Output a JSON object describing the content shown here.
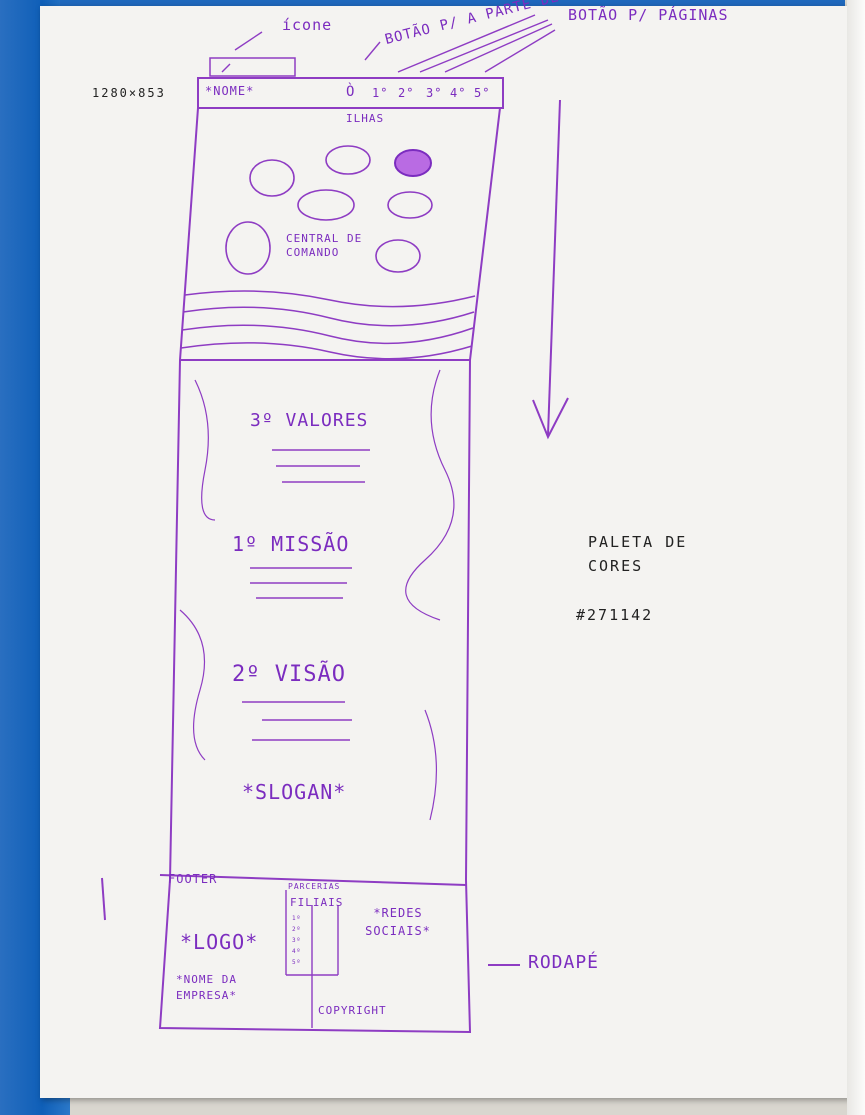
{
  "annotations": {
    "icone": "ícone",
    "botao_parte_de": "BOTÃO P/ A PARTE DE Q.M",
    "botao_paginas": "BOTÃO P/ PÁGINAS",
    "resolution": "1280×853",
    "nome": "*NOME*",
    "nav_items": [
      "1°",
      "2°",
      "3°",
      "4°",
      "5°"
    ],
    "ilhas": "ILHAS",
    "central": "CENTRAL DE COMANDO",
    "valores": "3º VALORES",
    "missao": "1º MISSÃO",
    "visao": "2º VISÃO",
    "slogan": "*SLOGAN*",
    "footer": "FOOTER",
    "parcerias": "PARCERIAS",
    "filiais": "FILIAIS",
    "redes": "*REDES SOCIAIS*",
    "logo": "*LOGO*",
    "nome_empresa": "*NOME DA EMPRESA*",
    "copyright": "COPYRIGHT",
    "list": [
      "1º",
      "2º",
      "3º",
      "4º",
      "5º"
    ],
    "rodape": "RODAPÉ",
    "paleta": "PALETA DE CORES",
    "color_code": "#271142"
  },
  "colors": {
    "ink": "#8e3cc3",
    "palette": "#271142"
  }
}
